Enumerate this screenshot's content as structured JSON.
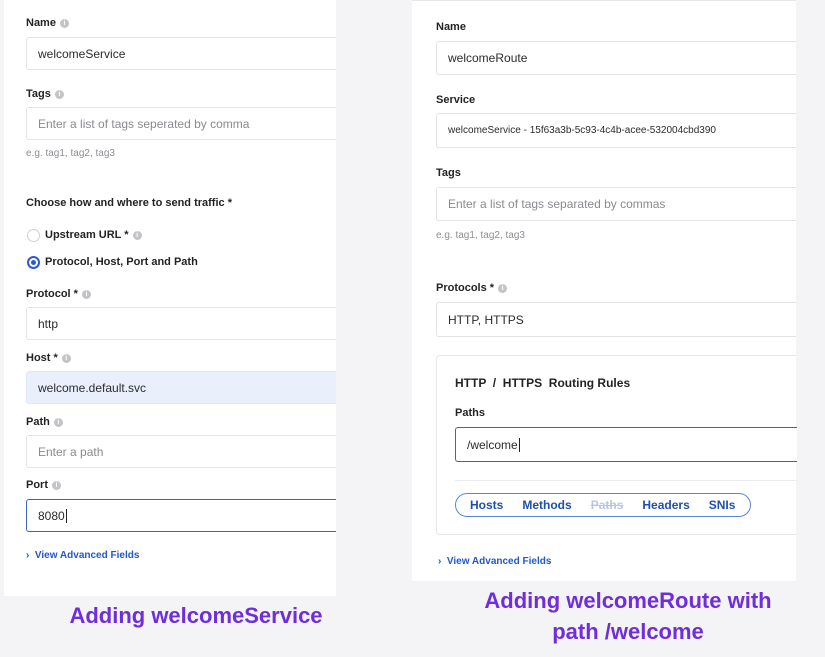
{
  "left": {
    "name_label": "Name",
    "name_value": "welcomeService",
    "tags_label": "Tags",
    "tags_placeholder": "Enter a list of tags seperated by comma",
    "tags_hint": "e.g. tag1, tag2, tag3",
    "traffic_heading": "Choose how and where to send traffic *",
    "option_upstream": "Upstream URL *",
    "option_protocol": "Protocol, Host, Port and Path",
    "protocol_label": "Protocol *",
    "protocol_value": "http",
    "host_label": "Host *",
    "host_value": "welcome.default.svc",
    "path_label": "Path",
    "path_placeholder": "Enter a path",
    "port_label": "Port",
    "port_value": "8080",
    "advanced": "View Advanced Fields",
    "caption": "Adding welcomeService"
  },
  "right": {
    "name_label": "Name",
    "name_value": "welcomeRoute",
    "service_label": "Service",
    "service_value": "welcomeService - 15f63a3b-5c93-4c4b-acee-532004cbd390",
    "tags_label": "Tags",
    "tags_placeholder": "Enter a list of tags separated by commas",
    "tags_hint": "e.g. tag1, tag2, tag3",
    "protocols_label": "Protocols *",
    "protocols_value": "HTTP, HTTPS",
    "rules_title": "HTTP  /  HTTPS  Routing Rules",
    "paths_label": "Paths",
    "paths_value": "/welcome",
    "tabs": [
      "Hosts",
      "Methods",
      "Paths",
      "Headers",
      "SNIs"
    ],
    "advanced": "View Advanced Fields",
    "caption_line1": "Adding welcomeRoute with",
    "caption_line2": "path /welcome"
  },
  "icons": {
    "info": "info-icon",
    "chevron": "chevron-right-icon"
  },
  "colors": {
    "accent": "#2c5ad0",
    "caption": "#6f2ddb",
    "link": "#2258c7"
  }
}
